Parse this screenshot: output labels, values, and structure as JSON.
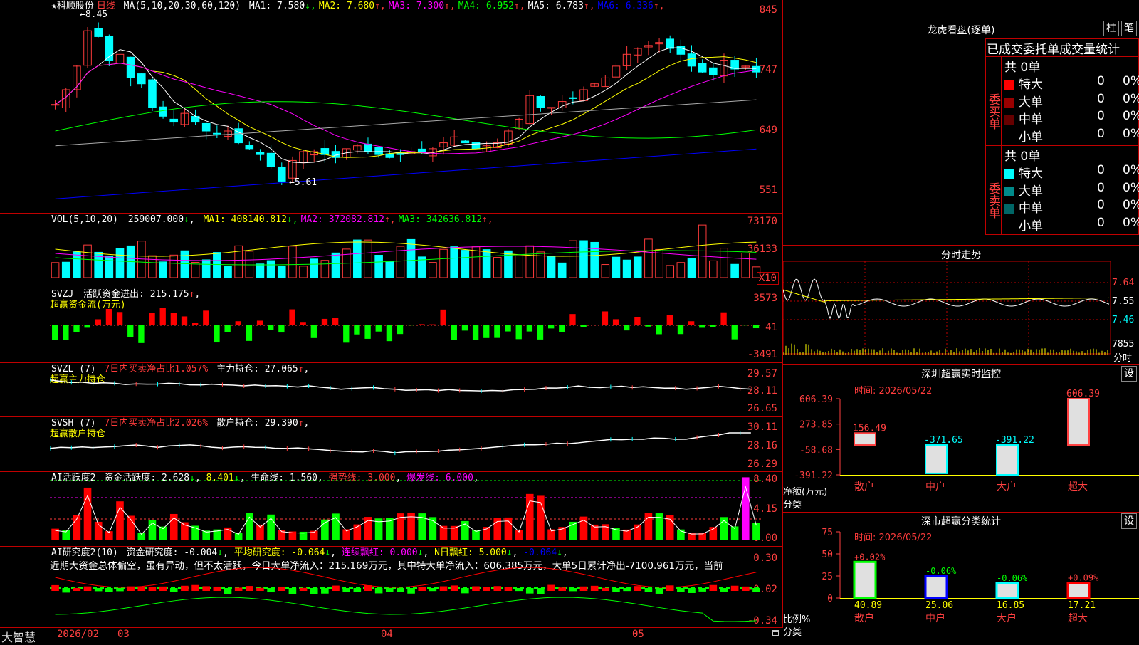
{
  "stock": {
    "name": "★科顺股份",
    "period": "日线"
  },
  "price_panel": {
    "ma_def": "MA(5,10,20,30,60,120)",
    "ma_labels": [
      {
        "text": "MA1: 7.580",
        "arrow": "↓",
        "color": "#ffffff"
      },
      {
        "text": "MA2: 7.680",
        "arrow": "↑",
        "color": "#ffff00"
      },
      {
        "text": "MA3: 7.300",
        "arrow": "↑",
        "color": "#ff00ff"
      },
      {
        "text": "MA4: 6.952",
        "arrow": "↑",
        "color": "#00ff00"
      },
      {
        "text": "MA5: 6.783",
        "arrow": "↑",
        "color": "#ffffff"
      },
      {
        "text": "MA6: 6.336",
        "arrow": "↑",
        "color": "#0000ff"
      }
    ],
    "axis_ticks": [
      "845",
      "747",
      "649",
      "551"
    ],
    "high_mark": "8.45",
    "low_mark": "5.61"
  },
  "vol_panel": {
    "def": "VOL(5,10,20)",
    "value": "259007.000",
    "ma_labels": [
      {
        "text": "MA1: 408140.812",
        "arrow": "↓",
        "color": "#ffff00"
      },
      {
        "text": "MA2: 372082.812",
        "arrow": "↑",
        "color": "#ff00ff"
      },
      {
        "text": "MA3: 342636.812",
        "arrow": "↑",
        "color": "#00ff00"
      }
    ],
    "axis_ticks": [
      "73170",
      "36133"
    ],
    "unit": "X10"
  },
  "svzj_panel": {
    "def": "SVZJ",
    "label": "活跃资金进出: 215.175",
    "arrow": "↑",
    "sub": "超赢资金流(万元)",
    "axis_ticks": [
      "3573",
      "41",
      "-3491"
    ]
  },
  "svzl_panel": {
    "def": "SVZL (7)",
    "label1": "7日内买卖净占比1.057%",
    "label2": "主力持仓: 27.065",
    "arrow": "↑",
    "sub": "超赢主力持仓",
    "axis_ticks": [
      "29.57",
      "28.11",
      "26.65"
    ]
  },
  "svsh_panel": {
    "def": "SVSH (7)",
    "label1": "7日内买卖净占比2.026%",
    "label2": "散户持仓: 29.390",
    "arrow": "↑",
    "sub": "超赢散户持仓",
    "axis_ticks": [
      "30.11",
      "28.16",
      "26.29"
    ]
  },
  "ai_active_panel": {
    "def": "AI活跃度2",
    "label1": "资金活跃度: 2.628",
    "label2": "8.401",
    "label3": "生命线: 1.560",
    "label4": "强势线: 3.000",
    "label5": "爆发线: 6.000",
    "axis_ticks": [
      "8.40",
      "4.15",
      "0.00"
    ]
  },
  "ai_research_panel": {
    "def": "AI研究度2(10)",
    "label1": "资金研究度: -0.004",
    "label2": "平均研究度: -0.064",
    "label3": "连续飘红: 0.000",
    "label4": "N日飘红: 5.000",
    "label5": "-0.064",
    "comment": "近期大资金总体偏空，虽有异动，但不太活跃，今日大单净流入：215.169万元，其中特大单净流入：606.385万元，大单5日累计净出-7100.961万元，当前",
    "axis_ticks": [
      "0.30",
      "-0.02",
      "-0.34"
    ]
  },
  "bottom_bar": {
    "brand": "大智慧",
    "dates": [
      "2026/02",
      "03",
      "04",
      "05"
    ]
  },
  "dragon_tiger": {
    "title": "龙虎看盘(逐单)",
    "btn_bar": "柱",
    "btn_tick": "笔",
    "tabs": "已成交委托单成交量统计",
    "buy": {
      "label": "委买单",
      "total": "共 0单",
      "rows": [
        {
          "name": "特大",
          "count": "0",
          "pct": "0%",
          "color": "#ff0000"
        },
        {
          "name": "大单",
          "count": "0",
          "pct": "0%",
          "color": "#990000"
        },
        {
          "name": "中单",
          "count": "0",
          "pct": "0%",
          "color": "#660000"
        },
        {
          "name": "小单",
          "count": "0",
          "pct": "0%",
          "color": "#000000"
        }
      ]
    },
    "sell": {
      "label": "委卖单",
      "total": "共 0单",
      "rows": [
        {
          "name": "特大",
          "count": "0",
          "pct": "0%",
          "color": "#00ffff"
        },
        {
          "name": "大单",
          "count": "0",
          "pct": "0%",
          "color": "#008b8b"
        },
        {
          "name": "中单",
          "count": "0",
          "pct": "0%",
          "color": "#006666"
        },
        {
          "name": "小单",
          "count": "0",
          "pct": "0%",
          "color": "#000000"
        }
      ]
    }
  },
  "intraday": {
    "title": "分时走势",
    "ticks": [
      "7.64",
      "7.55",
      "7.46"
    ],
    "vol_label": "7855",
    "vol_unit": "分时"
  },
  "realtime_monitor": {
    "title": "深圳超赢实时监控",
    "btn": "设",
    "time_label": "时间: 2026/05/22",
    "ylabel1": "净额(万元)",
    "ylabel2": "分类",
    "axis_ticks": [
      "606.39",
      "273.85",
      "-58.68",
      "-391.22"
    ]
  },
  "category_stats": {
    "title": "深市超赢分类统计",
    "btn": "设",
    "time_label": "时间: 2026/05/22",
    "ylabel1": "比例%",
    "ylabel2": "分类",
    "axis_ticks": [
      "75",
      "50",
      "25",
      "0"
    ]
  },
  "chart_data": [
    {
      "type": "bar",
      "title": "深圳超赢实时监控",
      "ylabel": "净额(万元)",
      "xlabel": "分类",
      "categories": [
        "散户",
        "中户",
        "大户",
        "超大"
      ],
      "values": [
        156.49,
        -371.65,
        -391.22,
        606.39
      ],
      "ylim": [
        -391.22,
        606.39
      ]
    },
    {
      "type": "bar",
      "title": "深市超赢分类统计",
      "ylabel": "比例%",
      "xlabel": "分类",
      "categories": [
        "散户",
        "中户",
        "大户",
        "超大"
      ],
      "values": [
        40.89,
        25.06,
        16.85,
        17.21
      ],
      "changes": [
        "+0.02%",
        "-0.06%",
        "-0.06%",
        "+0.09%"
      ],
      "ylim": [
        0,
        75
      ]
    }
  ]
}
